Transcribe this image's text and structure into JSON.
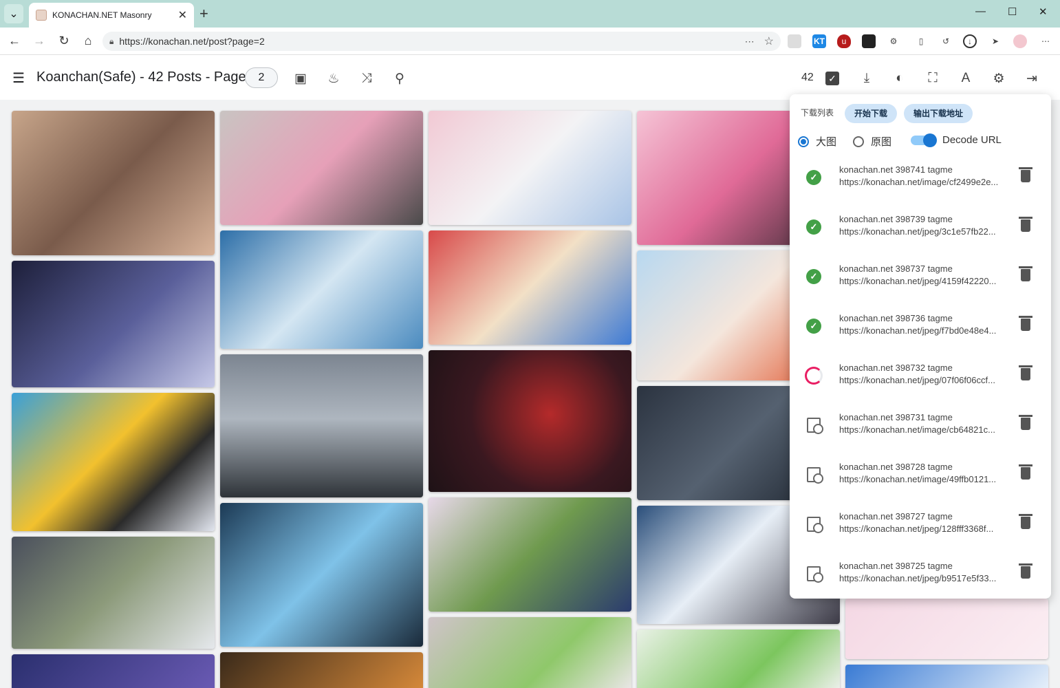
{
  "browser": {
    "tab_title": "KONACHAN.NET Masonry",
    "url": "https://konachan.net/post?page=2"
  },
  "app": {
    "title": "Koanchan(Safe) - 42 Posts - Page",
    "page": "2",
    "selected_count": "42"
  },
  "panel": {
    "header": "下载列表",
    "start_download": "开始下载",
    "export_urls": "输出下载地址",
    "opt_large": "大图",
    "opt_original": "原图",
    "opt_decode": "Decode URL",
    "items": [
      {
        "title": "konachan.net 398741 tagme",
        "url": "https://konachan.net/image/cf2499e2e...",
        "status": "done"
      },
      {
        "title": "konachan.net 398739 tagme",
        "url": "https://konachan.net/jpeg/3c1e57fb22...",
        "status": "done"
      },
      {
        "title": "konachan.net 398737 tagme",
        "url": "https://konachan.net/jpeg/4159f42220...",
        "status": "done"
      },
      {
        "title": "konachan.net 398736 tagme",
        "url": "https://konachan.net/jpeg/f7bd0e48e4...",
        "status": "done"
      },
      {
        "title": "konachan.net 398732 tagme",
        "url": "https://konachan.net/jpeg/07f06f06ccf...",
        "status": "downloading"
      },
      {
        "title": "konachan.net 398731 tagme",
        "url": "https://konachan.net/image/cb64821c...",
        "status": "pending"
      },
      {
        "title": "konachan.net 398728 tagme",
        "url": "https://konachan.net/image/49ffb0121...",
        "status": "pending"
      },
      {
        "title": "konachan.net 398727 tagme",
        "url": "https://konachan.net/jpeg/128fff3368f...",
        "status": "pending"
      },
      {
        "title": "konachan.net 398725 tagme",
        "url": "https://konachan.net/jpeg/b9517e5f33...",
        "status": "pending"
      }
    ]
  },
  "colors": {
    "accent": "#1976d2",
    "success": "#43a047",
    "progress": "#e91e63"
  }
}
